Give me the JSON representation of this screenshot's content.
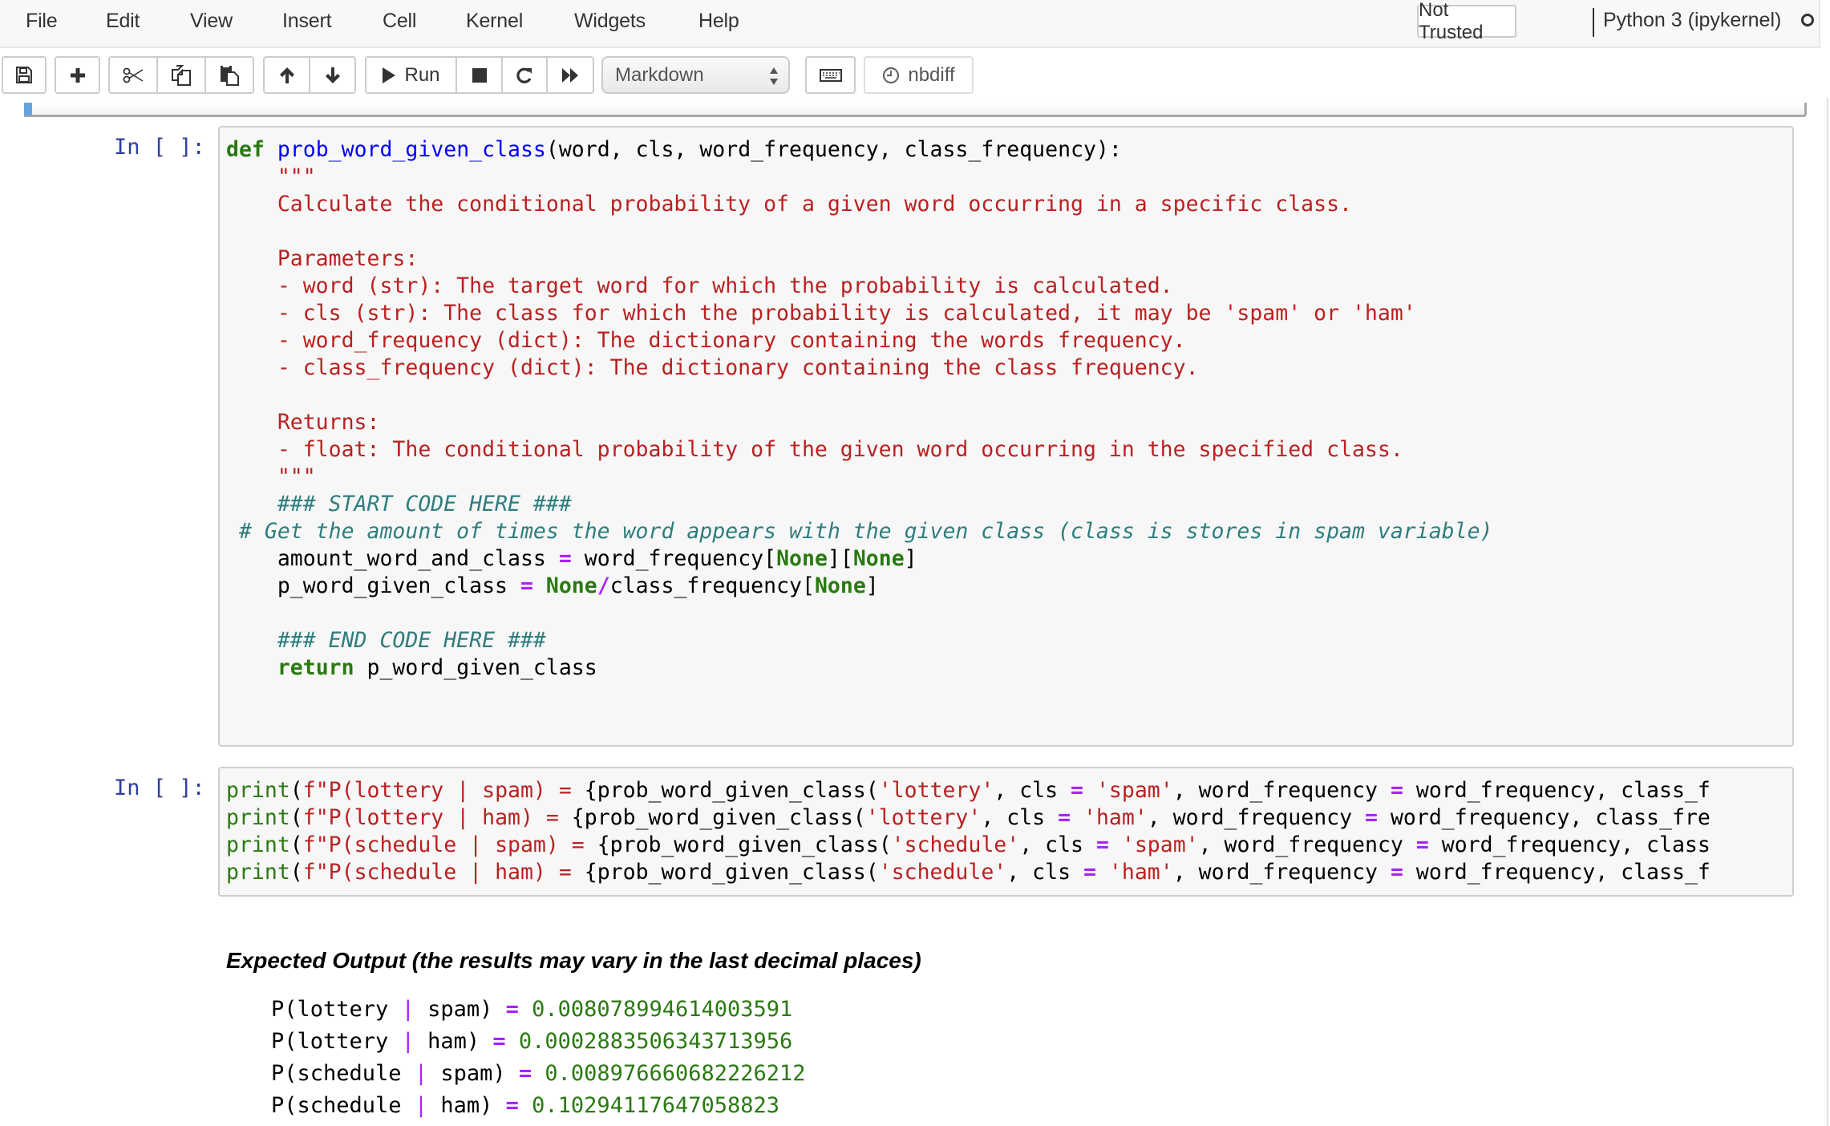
{
  "menu": {
    "items": [
      "File",
      "Edit",
      "View",
      "Insert",
      "Cell",
      "Kernel",
      "Widgets",
      "Help"
    ],
    "trust_status": "Not Trusted",
    "kernel_name": "Python 3 (ipykernel)",
    "kernel_status": "idle"
  },
  "toolbar": {
    "buttons": [
      {
        "name": "save",
        "icon": "floppy-disk-icon"
      },
      {
        "name": "insert-cell-below",
        "icon": "plus-icon"
      },
      {
        "name": "cut",
        "icon": "scissors-icon"
      },
      {
        "name": "copy",
        "icon": "copy-icon"
      },
      {
        "name": "paste",
        "icon": "paste-icon"
      },
      {
        "name": "move-up",
        "icon": "arrow-up-icon"
      },
      {
        "name": "move-down",
        "icon": "arrow-down-icon"
      },
      {
        "name": "run",
        "icon": "play-icon",
        "label": "Run"
      },
      {
        "name": "interrupt",
        "icon": "stop-icon"
      },
      {
        "name": "restart",
        "icon": "restart-icon"
      },
      {
        "name": "restart-run-all",
        "icon": "fast-forward-icon"
      },
      {
        "name": "command-palette",
        "icon": "keyboard-icon"
      },
      {
        "name": "nbdiff",
        "icon": "clock-icon",
        "label": "nbdiff"
      }
    ],
    "run_label": "Run",
    "cell_type": "Markdown",
    "nbdiff_label": "nbdiff"
  },
  "cells": [
    {
      "prompt": "In [ ]:",
      "type": "code",
      "lines": [
        "def prob_word_given_class(word, cls, word_frequency, class_frequency):",
        "    \"\"\"",
        "    Calculate the conditional probability of a given word occurring in a specific class.",
        "",
        "    Parameters:",
        "    - word (str): The target word for which the probability is calculated.",
        "    - cls (str): The class for which the probability is calculated, it may be 'spam' or 'ham'",
        "    - word_frequency (dict): The dictionary containing the words frequency.",
        "    - class_frequency (dict): The dictionary containing the class frequency.",
        "",
        "    Returns:",
        "    - float: The conditional probability of the given word occurring in the specified class.",
        "    \"\"\"",
        "    ### START CODE HERE ###",
        " # Get the amount of times the word appears with the given class (class is stores in spam variable)",
        "    amount_word_and_class = word_frequency[None][None]",
        "    p_word_given_class = None/class_frequency[None]",
        "",
        "    ### END CODE HERE ###",
        "    return p_word_given_class"
      ]
    },
    {
      "prompt": "In [ ]:",
      "type": "code",
      "lines": [
        "print(f\"P(lottery | spam) = {prob_word_given_class('lottery', cls = 'spam', word_frequency = word_frequency, class_f",
        "print(f\"P(lottery | ham) = {prob_word_given_class('lottery', cls = 'ham', word_frequency = word_frequency, class_fre",
        "print(f\"P(schedule | spam) = {prob_word_given_class('schedule', cls = 'spam', word_frequency = word_frequency, class",
        "print(f\"P(schedule | ham) = {prob_word_given_class('schedule', cls = 'ham', word_frequency = word_frequency, class_f"
      ]
    }
  ],
  "expected_output": {
    "heading": "Expected Output (the results may vary in the last decimal places)",
    "rows": [
      {
        "word": "lottery",
        "cls": "spam",
        "value": "0.008078994614003591"
      },
      {
        "word": "lottery",
        "cls": "ham",
        "value": "0.0002883506343713956"
      },
      {
        "word": "schedule",
        "cls": "spam",
        "value": "0.008976660682226212"
      },
      {
        "word": "schedule",
        "cls": "ham",
        "value": "0.10294117647058823"
      }
    ]
  }
}
